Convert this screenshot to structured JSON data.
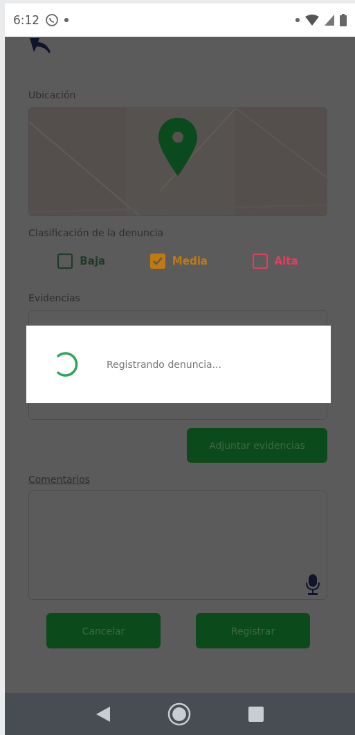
{
  "status_bar": {
    "time": "6:12"
  },
  "location": {
    "label": "Ubicación"
  },
  "classification": {
    "label": "Clasificación de la denuncia",
    "options": [
      {
        "label": "Baja",
        "checked": false,
        "color": "#1f3a26"
      },
      {
        "label": "Media",
        "checked": true,
        "color": "#c07a10"
      },
      {
        "label": "Alta",
        "checked": false,
        "color": "#e0405c"
      }
    ]
  },
  "evidence": {
    "label": "Evidencias",
    "attach_button": "Adjuntar evidencias"
  },
  "comments": {
    "label": "Comentarios"
  },
  "buttons": [
    "Cancelar",
    "Registrar"
  ],
  "progress_dialog": {
    "message": "Registrando denuncia..."
  }
}
